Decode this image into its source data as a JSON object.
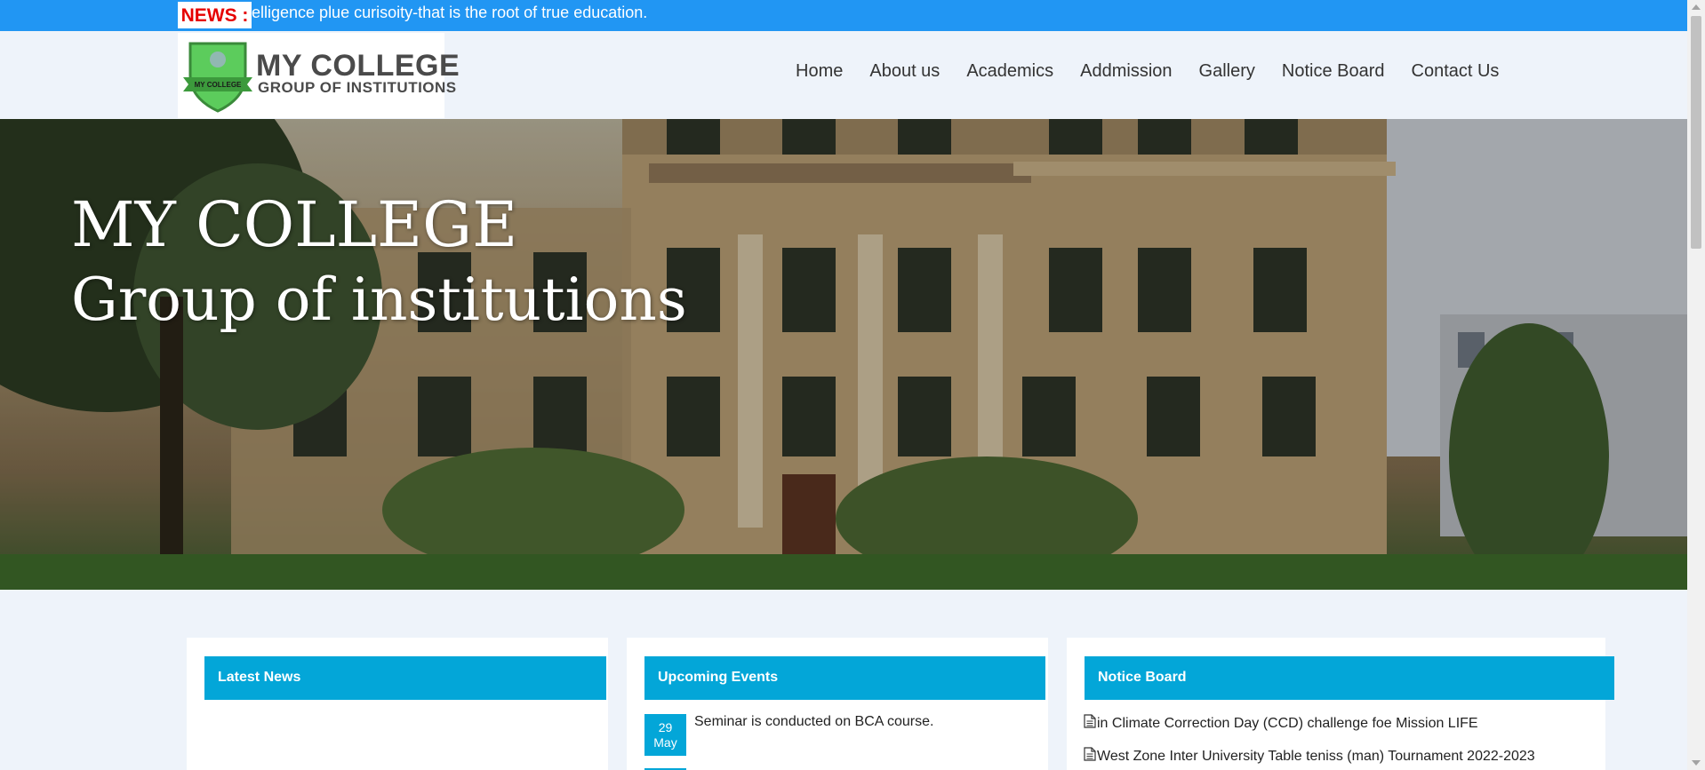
{
  "ticker": {
    "label": "NEWS :",
    "text": "elligence plue curisoity-that is the root of true education."
  },
  "logo": {
    "title": "MY COLLEGE",
    "subtitle": "GROUP OF INSTITUTIONS",
    "badge_text": "MY COLLEGE"
  },
  "nav": [
    "Home",
    "About us",
    "Academics",
    "Addmission",
    "Gallery",
    "Notice Board",
    "Contact Us"
  ],
  "hero": {
    "line1": "MY COLLEGE",
    "line2": "Group of institutions"
  },
  "latest_news": {
    "title": "Latest News"
  },
  "upcoming_events": {
    "title": "Upcoming Events",
    "items": [
      {
        "day": "29",
        "month": "May",
        "text": "Seminar is conducted on BCA course."
      }
    ]
  },
  "notice_board": {
    "title": "Notice Board",
    "items": [
      "in Climate Correction Day (CCD) challenge foe Mission LIFE",
      "West Zone Inter University Table teniss (man) Tournament 2022-2023"
    ]
  },
  "colors": {
    "ticker_bg": "#2196f3",
    "news_label": "#e60000",
    "box_header": "#03a6d8",
    "page_bg": "#eef3fa",
    "logo_green": "#5ccc5c"
  },
  "icons": {
    "notice_item": "document-icon",
    "logo": "shield-logo-icon"
  }
}
